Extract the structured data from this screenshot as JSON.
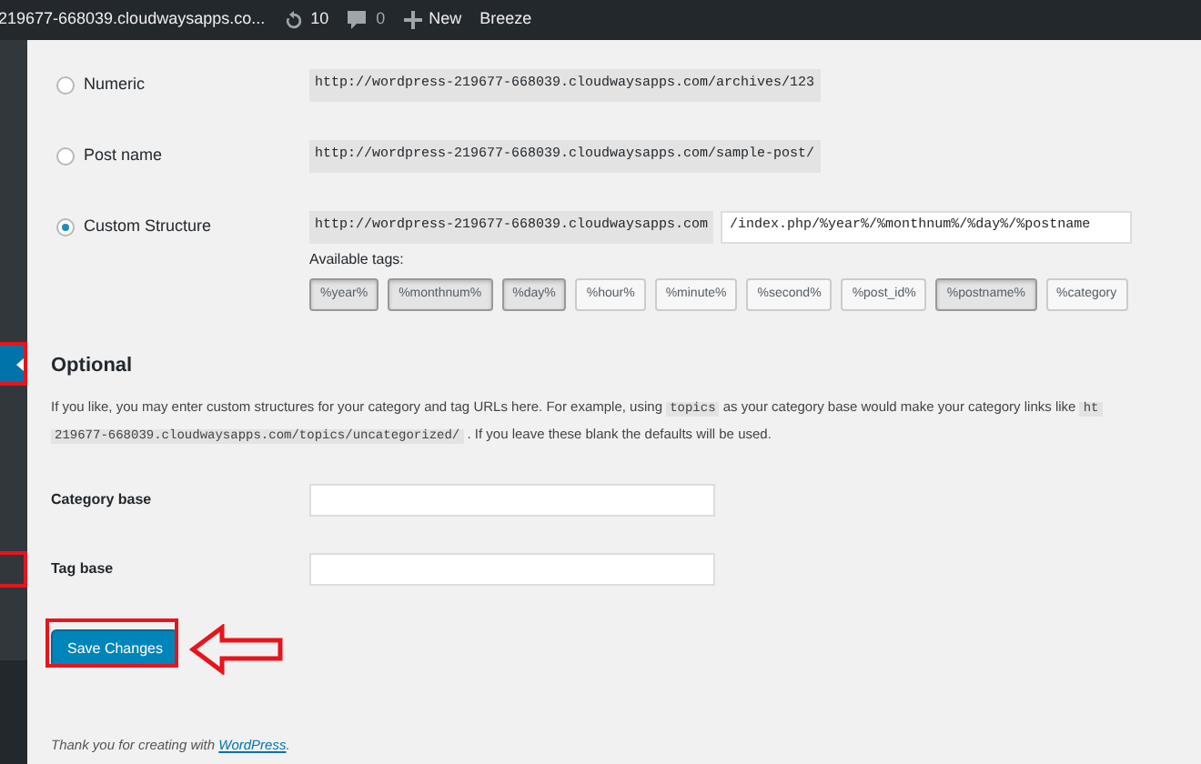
{
  "admin_bar": {
    "site": "219677-668039.cloudwaysapps.co...",
    "updates": "10",
    "comments": "0",
    "new": "New",
    "plugin": "Breeze"
  },
  "structures": [
    {
      "label": "Numeric",
      "selected": false,
      "url": "http://wordpress-219677-668039.cloudwaysapps.com/archives/123"
    },
    {
      "label": "Post name",
      "selected": false,
      "url": "http://wordpress-219677-668039.cloudwaysapps.com/sample-post/"
    },
    {
      "label": "Custom Structure",
      "selected": true,
      "url": "http://wordpress-219677-668039.cloudwaysapps.com",
      "value": "/index.php/%year%/%monthnum%/%day%/%postname"
    }
  ],
  "available_tags": {
    "label": "Available tags:",
    "tags": [
      {
        "label": "%year%",
        "selected": true
      },
      {
        "label": "%monthnum%",
        "selected": true
      },
      {
        "label": "%day%",
        "selected": true
      },
      {
        "label": "%hour%",
        "selected": false
      },
      {
        "label": "%minute%",
        "selected": false
      },
      {
        "label": "%second%",
        "selected": false
      },
      {
        "label": "%post_id%",
        "selected": false
      },
      {
        "label": "%postname%",
        "selected": true
      },
      {
        "label": "%category",
        "selected": false
      }
    ]
  },
  "optional": {
    "heading": "Optional",
    "lines": [
      [
        {
          "kind": "text",
          "text": "If you like, you may enter custom structures for your category and tag URLs here. For example, using "
        },
        {
          "kind": "code",
          "text": "topics"
        },
        {
          "kind": "text",
          "text": " as your category base would make your category links like "
        },
        {
          "kind": "code",
          "text": "ht"
        }
      ],
      [
        {
          "kind": "code",
          "text": "219677-668039.cloudwaysapps.com/topics/uncategorized/"
        },
        {
          "kind": "text",
          "text": " . If you leave these blank the defaults will be used."
        }
      ]
    ]
  },
  "fields": [
    {
      "label": "Category base"
    },
    {
      "label": "Tag base"
    }
  ],
  "save_button": "Save Changes",
  "footer": {
    "text": "Thank you for creating with ",
    "link": "WordPress",
    "end": "."
  }
}
